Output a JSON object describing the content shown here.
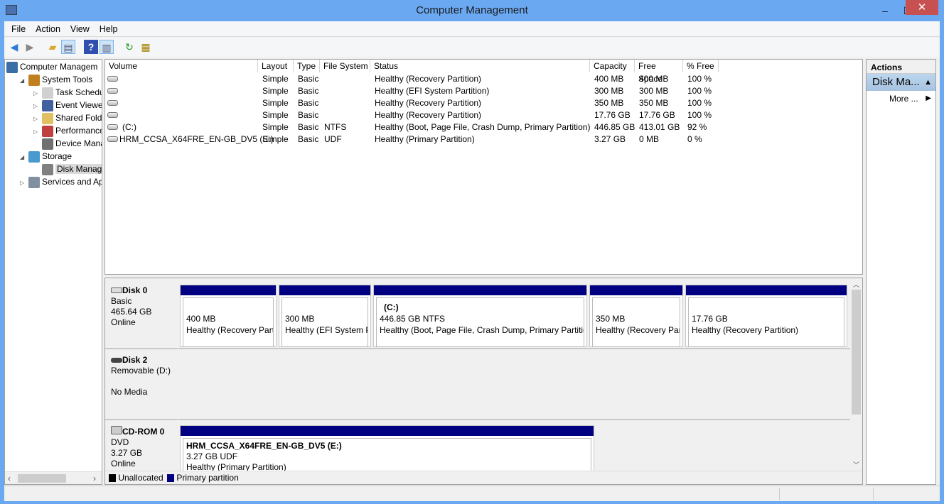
{
  "window": {
    "title": "Computer Management",
    "min": "‒",
    "max": "☐",
    "close": "✕"
  },
  "menu": [
    "File",
    "Action",
    "View",
    "Help"
  ],
  "tree": [
    {
      "label": "Computer Managem",
      "level": 0,
      "exp": "",
      "color": "#3a6ea5"
    },
    {
      "label": "System Tools",
      "level": 1,
      "exp": "◢",
      "color": "#c08020"
    },
    {
      "label": "Task Schedule",
      "level": 2,
      "exp": "▷",
      "color": "#d0d0d0"
    },
    {
      "label": "Event Viewer",
      "level": 2,
      "exp": "▷",
      "color": "#4060a0"
    },
    {
      "label": "Shared Folder",
      "level": 2,
      "exp": "▷",
      "color": "#e0c060"
    },
    {
      "label": "Performance",
      "level": 2,
      "exp": "▷",
      "color": "#c04040"
    },
    {
      "label": "Device Manag",
      "level": 2,
      "exp": "",
      "color": "#707070"
    },
    {
      "label": "Storage",
      "level": 1,
      "exp": "◢",
      "color": "#4a9ad0"
    },
    {
      "label": "Disk Manager",
      "level": 2,
      "exp": "",
      "color": "#808080",
      "selected": true
    },
    {
      "label": "Services and App",
      "level": 1,
      "exp": "▷",
      "color": "#8090a0"
    }
  ],
  "columns": [
    "Volume",
    "Layout",
    "Type",
    "File System",
    "Status",
    "Capacity",
    "Free Space",
    "% Free"
  ],
  "volumes": [
    [
      "",
      "Simple",
      "Basic",
      "",
      "Healthy (Recovery Partition)",
      "400 MB",
      "400 MB",
      "100 %"
    ],
    [
      "",
      "Simple",
      "Basic",
      "",
      "Healthy (EFI System Partition)",
      "300 MB",
      "300 MB",
      "100 %"
    ],
    [
      "",
      "Simple",
      "Basic",
      "",
      "Healthy (Recovery Partition)",
      "350 MB",
      "350 MB",
      "100 %"
    ],
    [
      "",
      "Simple",
      "Basic",
      "",
      "Healthy (Recovery Partition)",
      "17.76 GB",
      "17.76 GB",
      "100 %"
    ],
    [
      "(C:)",
      "Simple",
      "Basic",
      "NTFS",
      "Healthy (Boot, Page File, Crash Dump, Primary Partition)",
      "446.85 GB",
      "413.01 GB",
      "92 %"
    ],
    [
      "HRM_CCSA_X64FRE_EN-GB_DV5 (E:)",
      "Simple",
      "Basic",
      "UDF",
      "Healthy (Primary Partition)",
      "3.27 GB",
      "0 MB",
      "0 %"
    ]
  ],
  "disks": {
    "disk0": {
      "name": "Disk 0",
      "lines": [
        "Basic",
        "465.64 GB",
        "Online"
      ],
      "parts": [
        {
          "title": "",
          "size": "400 MB",
          "status": "Healthy (Recovery Parti"
        },
        {
          "title": "",
          "size": "300 MB",
          "status": "Healthy (EFI System Pa"
        },
        {
          "title": "(C:)",
          "size": "446.85 GB NTFS",
          "status": "Healthy (Boot, Page File, Crash Dump, Primary Partitio"
        },
        {
          "title": "",
          "size": "350 MB",
          "status": "Healthy (Recovery Part"
        },
        {
          "title": "",
          "size": "17.76 GB",
          "status": "Healthy (Recovery Partition)"
        }
      ]
    },
    "disk2": {
      "name": "Disk 2",
      "type": "Removable (D:)",
      "media": "No Media"
    },
    "cdrom": {
      "name": "CD-ROM 0",
      "lines": [
        "DVD",
        "3.27 GB",
        "Online"
      ],
      "part": {
        "title": "HRM_CCSA_X64FRE_EN-GB_DV5  (E:)",
        "size": "3.27 GB UDF",
        "status": "Healthy (Primary Partition)"
      }
    }
  },
  "legend": {
    "unallocated": "Unallocated",
    "primary": "Primary partition",
    "colors": {
      "unallocated": "#000000",
      "primary": "#000080"
    }
  },
  "actions": {
    "title": "Actions",
    "section": "Disk Ma...",
    "more": "More ..."
  }
}
